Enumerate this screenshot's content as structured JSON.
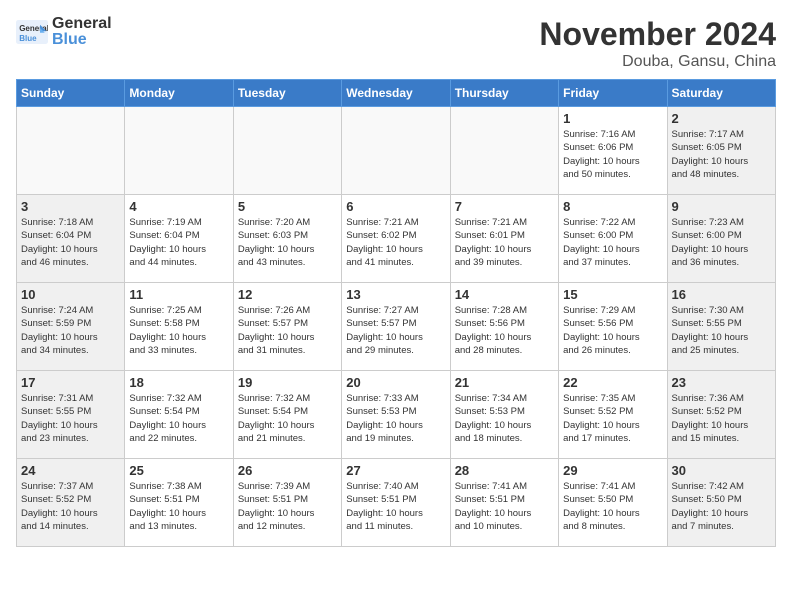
{
  "header": {
    "logo_general": "General",
    "logo_blue": "Blue",
    "title": "November 2024",
    "subtitle": "Douba, Gansu, China"
  },
  "weekdays": [
    "Sunday",
    "Monday",
    "Tuesday",
    "Wednesday",
    "Thursday",
    "Friday",
    "Saturday"
  ],
  "weeks": [
    [
      {
        "day": "",
        "info": ""
      },
      {
        "day": "",
        "info": ""
      },
      {
        "day": "",
        "info": ""
      },
      {
        "day": "",
        "info": ""
      },
      {
        "day": "",
        "info": ""
      },
      {
        "day": "1",
        "info": "Sunrise: 7:16 AM\nSunset: 6:06 PM\nDaylight: 10 hours\nand 50 minutes."
      },
      {
        "day": "2",
        "info": "Sunrise: 7:17 AM\nSunset: 6:05 PM\nDaylight: 10 hours\nand 48 minutes."
      }
    ],
    [
      {
        "day": "3",
        "info": "Sunrise: 7:18 AM\nSunset: 6:04 PM\nDaylight: 10 hours\nand 46 minutes."
      },
      {
        "day": "4",
        "info": "Sunrise: 7:19 AM\nSunset: 6:04 PM\nDaylight: 10 hours\nand 44 minutes."
      },
      {
        "day": "5",
        "info": "Sunrise: 7:20 AM\nSunset: 6:03 PM\nDaylight: 10 hours\nand 43 minutes."
      },
      {
        "day": "6",
        "info": "Sunrise: 7:21 AM\nSunset: 6:02 PM\nDaylight: 10 hours\nand 41 minutes."
      },
      {
        "day": "7",
        "info": "Sunrise: 7:21 AM\nSunset: 6:01 PM\nDaylight: 10 hours\nand 39 minutes."
      },
      {
        "day": "8",
        "info": "Sunrise: 7:22 AM\nSunset: 6:00 PM\nDaylight: 10 hours\nand 37 minutes."
      },
      {
        "day": "9",
        "info": "Sunrise: 7:23 AM\nSunset: 6:00 PM\nDaylight: 10 hours\nand 36 minutes."
      }
    ],
    [
      {
        "day": "10",
        "info": "Sunrise: 7:24 AM\nSunset: 5:59 PM\nDaylight: 10 hours\nand 34 minutes."
      },
      {
        "day": "11",
        "info": "Sunrise: 7:25 AM\nSunset: 5:58 PM\nDaylight: 10 hours\nand 33 minutes."
      },
      {
        "day": "12",
        "info": "Sunrise: 7:26 AM\nSunset: 5:57 PM\nDaylight: 10 hours\nand 31 minutes."
      },
      {
        "day": "13",
        "info": "Sunrise: 7:27 AM\nSunset: 5:57 PM\nDaylight: 10 hours\nand 29 minutes."
      },
      {
        "day": "14",
        "info": "Sunrise: 7:28 AM\nSunset: 5:56 PM\nDaylight: 10 hours\nand 28 minutes."
      },
      {
        "day": "15",
        "info": "Sunrise: 7:29 AM\nSunset: 5:56 PM\nDaylight: 10 hours\nand 26 minutes."
      },
      {
        "day": "16",
        "info": "Sunrise: 7:30 AM\nSunset: 5:55 PM\nDaylight: 10 hours\nand 25 minutes."
      }
    ],
    [
      {
        "day": "17",
        "info": "Sunrise: 7:31 AM\nSunset: 5:55 PM\nDaylight: 10 hours\nand 23 minutes."
      },
      {
        "day": "18",
        "info": "Sunrise: 7:32 AM\nSunset: 5:54 PM\nDaylight: 10 hours\nand 22 minutes."
      },
      {
        "day": "19",
        "info": "Sunrise: 7:32 AM\nSunset: 5:54 PM\nDaylight: 10 hours\nand 21 minutes."
      },
      {
        "day": "20",
        "info": "Sunrise: 7:33 AM\nSunset: 5:53 PM\nDaylight: 10 hours\nand 19 minutes."
      },
      {
        "day": "21",
        "info": "Sunrise: 7:34 AM\nSunset: 5:53 PM\nDaylight: 10 hours\nand 18 minutes."
      },
      {
        "day": "22",
        "info": "Sunrise: 7:35 AM\nSunset: 5:52 PM\nDaylight: 10 hours\nand 17 minutes."
      },
      {
        "day": "23",
        "info": "Sunrise: 7:36 AM\nSunset: 5:52 PM\nDaylight: 10 hours\nand 15 minutes."
      }
    ],
    [
      {
        "day": "24",
        "info": "Sunrise: 7:37 AM\nSunset: 5:52 PM\nDaylight: 10 hours\nand 14 minutes."
      },
      {
        "day": "25",
        "info": "Sunrise: 7:38 AM\nSunset: 5:51 PM\nDaylight: 10 hours\nand 13 minutes."
      },
      {
        "day": "26",
        "info": "Sunrise: 7:39 AM\nSunset: 5:51 PM\nDaylight: 10 hours\nand 12 minutes."
      },
      {
        "day": "27",
        "info": "Sunrise: 7:40 AM\nSunset: 5:51 PM\nDaylight: 10 hours\nand 11 minutes."
      },
      {
        "day": "28",
        "info": "Sunrise: 7:41 AM\nSunset: 5:51 PM\nDaylight: 10 hours\nand 10 minutes."
      },
      {
        "day": "29",
        "info": "Sunrise: 7:41 AM\nSunset: 5:50 PM\nDaylight: 10 hours\nand 8 minutes."
      },
      {
        "day": "30",
        "info": "Sunrise: 7:42 AM\nSunset: 5:50 PM\nDaylight: 10 hours\nand 7 minutes."
      }
    ]
  ]
}
